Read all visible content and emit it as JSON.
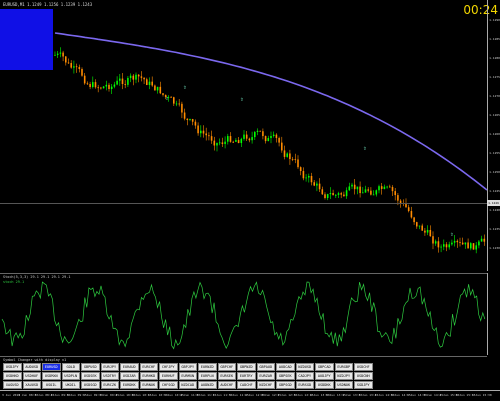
{
  "chart": {
    "info": "EURUSD,M1 1.1249 1.1256 1.1239 1.1243",
    "timer": "00:24",
    "price_labels": [
      "1.1290",
      "1.1285",
      "1.1280",
      "1.1275",
      "1.1270",
      "1.1265",
      "1.1260",
      "1.1255",
      "1.1250",
      "1.1245",
      "1.1240",
      "1.1235",
      "1.1230"
    ],
    "current_price": "1.1246",
    "colors": {
      "bull": "#00ff00",
      "bear": "#ff8c00",
      "ma": "#7b68ee",
      "osc": "#2ecc40",
      "arrow": "#7fffd4"
    }
  },
  "oscillator": {
    "title": "Stoch(5,3,3) 29.1 29.1 29.1 29.1",
    "subtitle": "stoch 29.1"
  },
  "symbol_panel": {
    "title": "Symbol Changer with display v1",
    "symbols": [
      "USDJPY",
      "AUDUSD",
      "EURUSD",
      "GOLD",
      "GBPUSD",
      "EURJPY",
      "EURAUD",
      "EURCHF",
      "CHFJPY",
      "GBPJPY",
      "EURNZD",
      "GBPCHF",
      "GBPNZD",
      "GBPAUD",
      "AUDCAD",
      "NZDUSD",
      "GBPCAD",
      "EURGBP",
      "USDCHF",
      "USDHKD",
      "USDHUF",
      "USDMXN",
      "USDPLN",
      "USDSEK",
      "USDTRY",
      "USDZAR",
      "EURHKD",
      "EURHUF",
      "EURMXN",
      "EURPLN",
      "EURSEK",
      "EURTRY",
      "EURZAR",
      "GBPSEK",
      "CADJPY",
      "AUDJPY",
      "NZDJPY",
      "USDCNH",
      "XAGUSD",
      "XAUUSD",
      "USOIL",
      "UKOIL",
      "USDSGD",
      "EURCZK",
      "EURDKK",
      "EURNOK",
      "CHFSGD",
      "NZDCAD",
      "AUDNZD",
      "AUDCHF",
      "CADCHF",
      "NZDCHF",
      "GBPSGD",
      "EURSGD",
      "USDDKK",
      "USDNOK",
      "SGDJPY"
    ],
    "active_index": 2
  },
  "time_axis": [
    "3 Jun 2019",
    "3 Jun 08:30",
    "3 Jun 08:45",
    "3 Jun 09:00",
    "3 Jun 09:15",
    "3 Jun 09:30",
    "3 Jun 09:45",
    "3 Jun 10:00",
    "3 Jun 10:15",
    "3 Jun 10:30",
    "3 Jun 10:45",
    "3 Jun 11:00",
    "3 Jun 11:15",
    "3 Jun 11:30",
    "3 Jun 11:45",
    "3 Jun 12:00",
    "3 Jun 12:15",
    "3 Jun 12:30",
    "3 Jun 12:45",
    "3 Jun 13:00",
    "3 Jun 13:15",
    "3 Jun 13:30",
    "3 Jun 13:45",
    "3 Jun 14:00",
    "3 Jun 14:15",
    "3 Jun 14:30",
    "3 Jun 14:45",
    "3 Jun 15:00",
    "3 Jun 15:15",
    "3 Jun 15:30"
  ]
}
